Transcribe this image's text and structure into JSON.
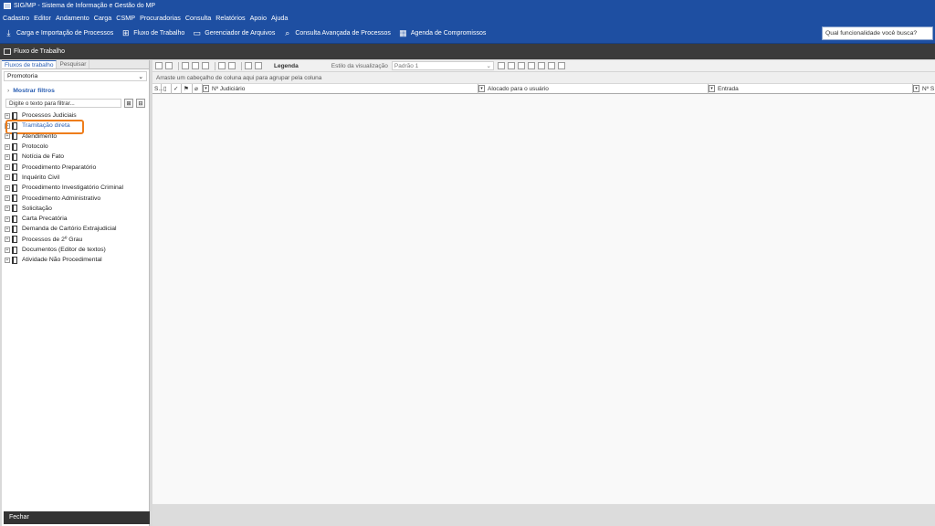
{
  "window": {
    "title": "SIG/MP - Sistema de Informação e Gestão do MP"
  },
  "menubar": {
    "items": [
      "Cadastro",
      "Editor",
      "Andamento",
      "Carga",
      "CSMP",
      "Procuradorias",
      "Consulta",
      "Relatórios",
      "Apoio",
      "Ajuda"
    ]
  },
  "toolbar": {
    "items": [
      {
        "label": "Carga e Importação de Processos",
        "icon": "download-icon"
      },
      {
        "label": "Fluxo de Trabalho",
        "icon": "workflow-icon"
      },
      {
        "label": "Gerenciador de Arquivos",
        "icon": "file-manager-icon"
      },
      {
        "label": "Consulta Avançada de Processos",
        "icon": "search-icon"
      },
      {
        "label": "Agenda de Compromissos",
        "icon": "calendar-icon"
      }
    ],
    "search_placeholder": "Qual funcionalidade você busca?"
  },
  "section_title": "Fluxo de Trabalho",
  "left_panel": {
    "tabs": [
      "Fluxos de trabalho",
      "Pesquisar"
    ],
    "selected_dropdown": "Promotoria",
    "show_filters_label": "Mostrar filtros",
    "filter_placeholder": "Digite o texto para filtrar...",
    "tree_items": [
      "Processos Judiciais",
      "Tramitação direta",
      "Atendimento",
      "Protocolo",
      "Notícia de Fato",
      "Procedimento Preparatório",
      "Inquérito Civil",
      "Procedimento Investigatório Criminal",
      "Procedimento Administrativo",
      "Solicitação",
      "Carta Precatória",
      "Demanda de Cartório Extrajudicial",
      "Processos de 2º Grau",
      "Documentos (Editor de textos)",
      "Atividade Não Procedimental"
    ],
    "close_label": "Fechar"
  },
  "grid": {
    "legend_label": "Legenda",
    "style_label": "Estilo da visualização",
    "style_value": "Padrão 1",
    "group_hint": "Arraste um cabeçalho de coluna aqui para agrupar pela coluna",
    "columns": [
      "S...",
      "Nº Judiciário",
      "Alocado para o usuário",
      "Entrada",
      "Nº S"
    ]
  }
}
